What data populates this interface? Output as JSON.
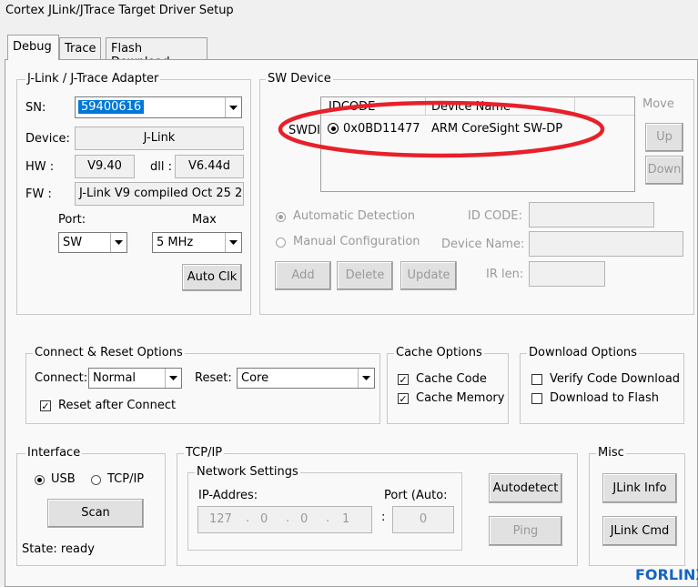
{
  "window": {
    "title": "Cortex JLink/JTrace Target Driver Setup"
  },
  "tabs": [
    {
      "label": "Debug"
    },
    {
      "label": "Trace"
    },
    {
      "label": "Flash Download"
    }
  ],
  "adapter": {
    "group_label": "J-Link / J-Trace Adapter",
    "sn_label": "SN:",
    "sn_value": "59400616",
    "device_label": "Device:",
    "device_value": "J-Link",
    "hw_label": "HW :",
    "hw_value": "V9.40",
    "dll_label": "dll :",
    "dll_value": "V6.44d",
    "fw_label": "FW :",
    "fw_value": "J-Link V9 compiled Oct 25 2",
    "port_label": "Port:",
    "port_value": "SW",
    "max_label": "Max",
    "max_value": "5 MHz",
    "autoclk_label": "Auto Clk"
  },
  "sw_device": {
    "group_label": "SW Device",
    "col_idcode": "IDCODE",
    "col_device": "Device Name",
    "row_prefix": "SWDI",
    "row_idcode": "0x0BD11477",
    "row_device": "ARM CoreSight SW-DP",
    "move_label": "Move",
    "up_label": "Up",
    "down_label": "Down",
    "auto_detect_label": "Automatic Detection",
    "manual_config_label": "Manual Configuration",
    "idcode_label": "ID CODE:",
    "device_name_label": "Device Name:",
    "irlen_label": "IR len:",
    "add_label": "Add",
    "delete_label": "Delete",
    "update_label": "Update",
    "highlight_color": "#e8202a"
  },
  "connect_reset": {
    "group_label": "Connect & Reset Options",
    "connect_label": "Connect:",
    "connect_value": "Normal",
    "reset_label": "Reset:",
    "reset_value": "Core",
    "reset_after_label": "Reset after Connect",
    "reset_after_checked": true
  },
  "cache": {
    "group_label": "Cache Options",
    "cache_code_label": "Cache Code",
    "cache_memory_label": "Cache Memory",
    "cache_code_checked": true,
    "cache_memory_checked": true
  },
  "download": {
    "group_label": "Download Options",
    "verify_label": "Verify Code Download",
    "flash_label": "Download to Flash",
    "verify_checked": false,
    "flash_checked": false
  },
  "interface": {
    "group_label": "Interface",
    "usb_label": "USB",
    "tcpip_label": "TCP/IP",
    "scan_label": "Scan",
    "state_text": "State: ready"
  },
  "tcpip": {
    "group_label": "TCP/IP",
    "network_label": "Network Settings",
    "ip_label": "IP-Addres:",
    "ip_parts": [
      "127",
      "0",
      "0",
      "1"
    ],
    "port_label": "Port (Auto:",
    "port_value": "0",
    "autodetect_label": "Autodetect",
    "ping_label": "Ping"
  },
  "misc": {
    "group_label": "Misc",
    "jlink_info_label": "JLink Info",
    "jlink_cmd_label": "JLink Cmd"
  },
  "watermark": {
    "text": "FORLINX",
    "color": "#1565c0"
  }
}
